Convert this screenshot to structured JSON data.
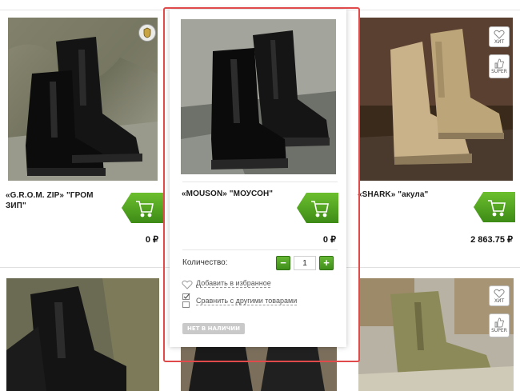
{
  "products": [
    {
      "name": "«G.R.O.M. ZIP» \"ГРОМ ЗИП\"",
      "price": "0 ₽",
      "badges": [
        "certificate-icon"
      ]
    },
    {
      "name": "«MOUSON» \"МОУСОН\"",
      "price": "0 ₽"
    },
    {
      "name": "«SHARK» \"акула\"",
      "price": "2 863.75 ₽",
      "badges": [
        "ХИТ",
        "SUPER"
      ]
    },
    {
      "name": "",
      "price": ""
    },
    {
      "name": "",
      "price": ""
    },
    {
      "name": "",
      "price": "",
      "badges": [
        "ХИТ",
        "SUPER"
      ]
    }
  ],
  "popup": {
    "qty_label": "Количество:",
    "qty_value": "1",
    "minus": "−",
    "plus": "+",
    "wishlist": "Добавить в избранное",
    "compare": "Сравнить с другими товарами",
    "out_of_stock": "НЕТ В НАЛИЧИИ"
  },
  "badge_labels": {
    "hit": "ХИТ",
    "super": "SUPER"
  },
  "colors": {
    "cart_green": "#4a9d22",
    "highlight_red": "#e14a4a",
    "out_of_stock_gray": "#c9c9c9"
  }
}
